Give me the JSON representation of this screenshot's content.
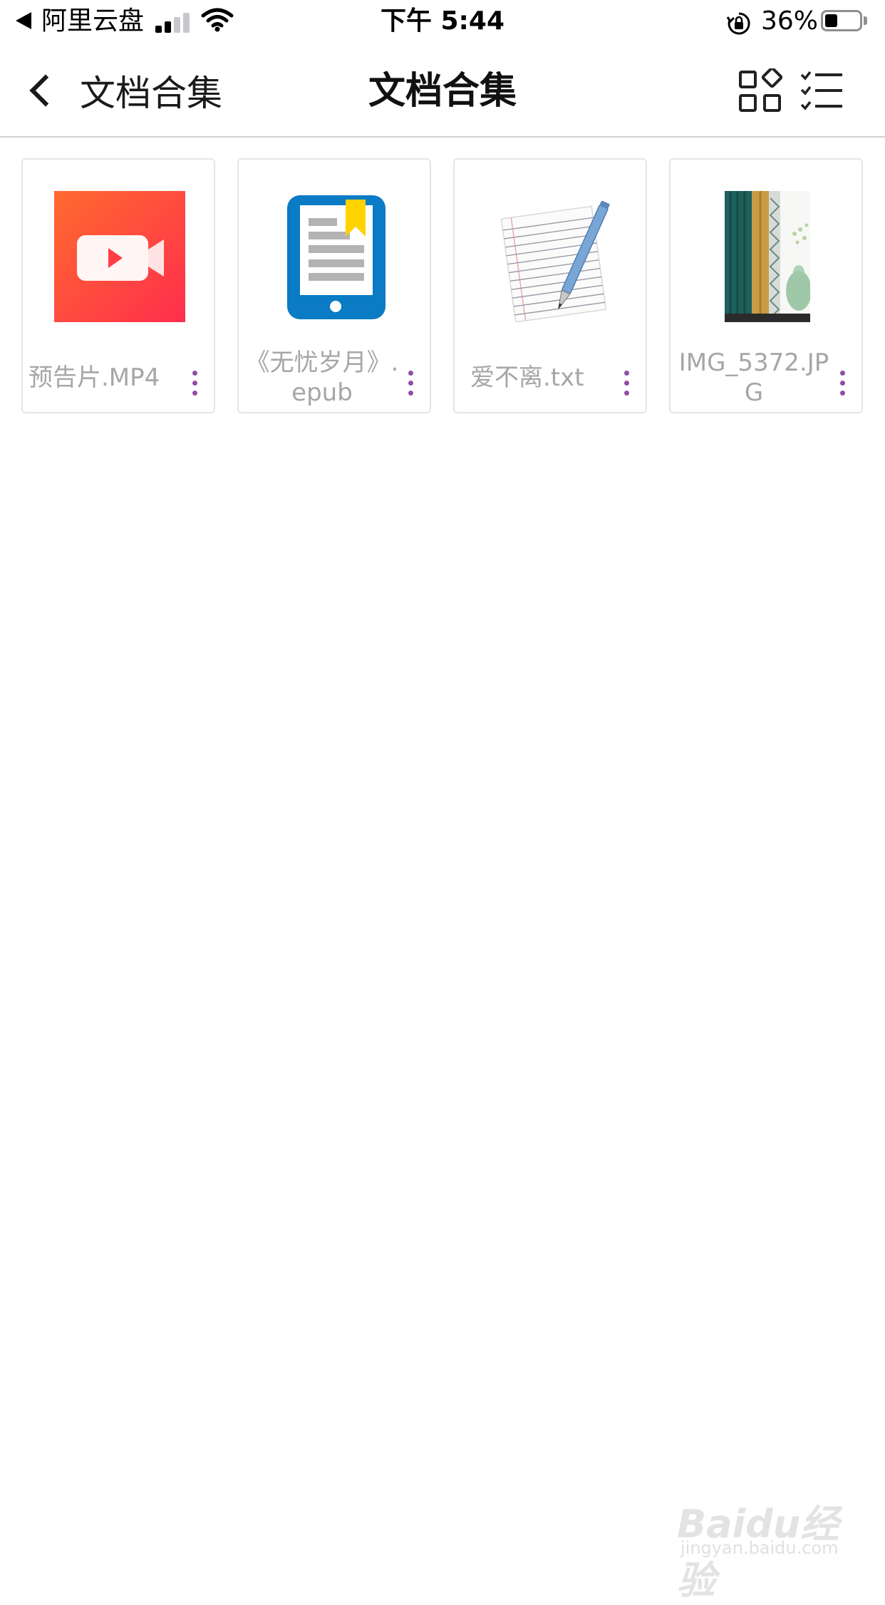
{
  "status_bar": {
    "app_name": "阿里云盘",
    "time": "下午 5:44",
    "battery_percent": "36%",
    "battery_level": 0.36,
    "signal_bars": 2
  },
  "nav": {
    "back_label": "文档合集",
    "title": "文档合集",
    "grid_view_icon": "grid-view-icon",
    "select_list_icon": "checklist-icon"
  },
  "files": [
    {
      "name": "预告片.MP4",
      "type": "video"
    },
    {
      "name": "《无忧岁月》.epub",
      "type": "epub"
    },
    {
      "name": "爱不离.txt",
      "type": "text"
    },
    {
      "name": "IMG_5372.JPG",
      "type": "image"
    }
  ],
  "colors": {
    "accent_more": "#8e4fa8",
    "video_gradient_start": "#ff6a2f",
    "video_gradient_end": "#ff2e4d",
    "epub_blue": "#0a7bc4",
    "epub_bookmark": "#ffd200"
  },
  "watermark": {
    "brand": "Baidu经验",
    "url": "jingyan.baidu.com"
  }
}
